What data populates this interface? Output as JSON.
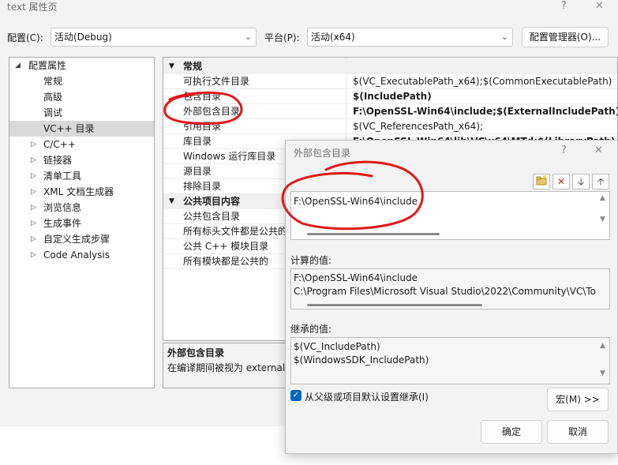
{
  "window": {
    "title": "text 属性页",
    "help_glyph": "?",
    "close_glyph": "✕"
  },
  "config": {
    "label": "配置(C):",
    "value": "活动(Debug)",
    "platform_label": "平台(P):",
    "platform_value": "活动(x64)",
    "manager_button": "配置管理器(O)..."
  },
  "tree": {
    "root": "配置属性",
    "items": [
      {
        "label": "常规",
        "expandable": false
      },
      {
        "label": "高级",
        "expandable": false
      },
      {
        "label": "调试",
        "expandable": false
      },
      {
        "label": "VC++ 目录",
        "expandable": false,
        "selected": true
      },
      {
        "label": "C/C++",
        "expandable": true
      },
      {
        "label": "链接器",
        "expandable": true
      },
      {
        "label": "清单工具",
        "expandable": true
      },
      {
        "label": "XML 文档生成器",
        "expandable": true
      },
      {
        "label": "浏览信息",
        "expandable": true
      },
      {
        "label": "生成事件",
        "expandable": true
      },
      {
        "label": "自定义生成步骤",
        "expandable": true
      },
      {
        "label": "Code Analysis",
        "expandable": true
      }
    ]
  },
  "grid": {
    "category_general": "常规",
    "general_rows": [
      {
        "name": "可执行文件目录",
        "value": "$(VC_ExecutablePath_x64);$(CommonExecutablePath)",
        "bold": false
      },
      {
        "name": "包含目录",
        "value": "$(IncludePath)",
        "bold": true
      },
      {
        "name": "外部包含目录",
        "value": "F:\\OpenSSL-Win64\\include;$(ExternalIncludePath)",
        "bold": true
      },
      {
        "name": "引用目录",
        "value": "$(VC_ReferencesPath_x64);",
        "bold": false
      },
      {
        "name": "库目录",
        "value": "F:\\OpenSSL-Win64\\lib\\VC\\x64\\MTd;$(LibraryPath)",
        "bold": true
      },
      {
        "name": "Windows 运行库目录",
        "value": "",
        "bold": false
      },
      {
        "name": "源目录",
        "value": "",
        "bold": false
      },
      {
        "name": "排除目录",
        "value": "",
        "bold": false
      }
    ],
    "category_public": "公共项目内容",
    "public_rows": [
      {
        "name": "公共包含目录",
        "value": ""
      },
      {
        "name": "所有标头文件都是公共的",
        "value": ""
      },
      {
        "name": "公共 C++ 模块目录",
        "value": ""
      },
      {
        "name": "所有模块都是公共的",
        "value": ""
      }
    ]
  },
  "description": {
    "title": "外部包含目录",
    "text": "在编译期间被视为 external/"
  },
  "dialog": {
    "title": "外部包含目录",
    "help_glyph": "?",
    "close_glyph": "✕",
    "edit_value": "F:\\OpenSSL-Win64\\include",
    "computed_label": "计算的值:",
    "computed_lines": [
      "F:\\OpenSSL-Win64\\include",
      "C:\\Program Files\\Microsoft Visual Studio\\2022\\Community\\VC\\To"
    ],
    "inherited_label": "继承的值:",
    "inherited_lines": [
      "$(VC_IncludePath)",
      "$(WindowsSDK_IncludePath)"
    ],
    "inherit_checkbox_label": "从父级或项目默认设置继承(I)",
    "inherit_checked": true,
    "macro_button": "宏(M) >>",
    "ok_button": "确定",
    "cancel_button": "取消"
  },
  "colors": {
    "accent": "#0067c0",
    "annotation_red": "#e01818",
    "delete_red": "#c42b1c"
  },
  "icons": {
    "new_line": "folder-new-icon",
    "delete": "delete-x-icon",
    "move_down": "arrow-down-icon",
    "move_up": "arrow-up-icon"
  }
}
